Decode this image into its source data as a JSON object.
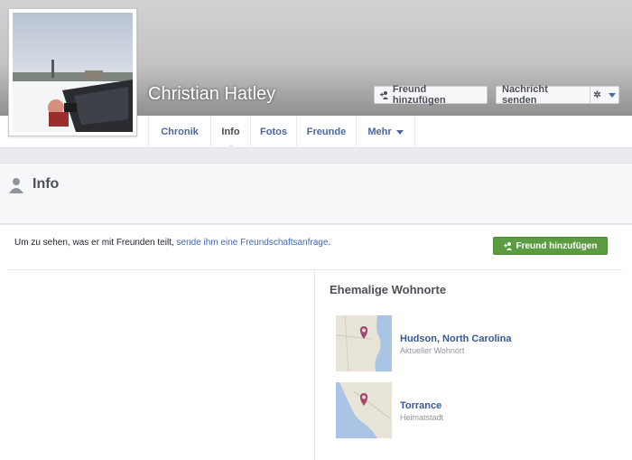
{
  "profile": {
    "name": "Christian Hatley"
  },
  "cover_buttons": {
    "add_friend": "Freund hinzufügen",
    "message": "Nachricht senden"
  },
  "tabs": [
    {
      "label": "Chronik"
    },
    {
      "label": "Info"
    },
    {
      "label": "Fotos"
    },
    {
      "label": "Freunde"
    },
    {
      "label": "Mehr"
    }
  ],
  "section": {
    "title": "Info"
  },
  "notice": {
    "text_before": "Um zu sehen, was er mit Freunden teilt, ",
    "link": "sende ihm eine Freundschaftsanfrage",
    "text_after": ".",
    "button": "Freund hinzufügen"
  },
  "places": {
    "title": "Ehemalige Wohnorte",
    "items": [
      {
        "name": "Hudson, North Carolina",
        "subtitle": "Aktueller Wohnort"
      },
      {
        "name": "Torrance",
        "subtitle": "Heimatstadt"
      }
    ]
  },
  "colors": {
    "link": "#365899",
    "green_button": "#5b9b42",
    "map_land": "#e8e4d8",
    "map_water": "#aac4e6",
    "pin": "#a24a6f"
  }
}
